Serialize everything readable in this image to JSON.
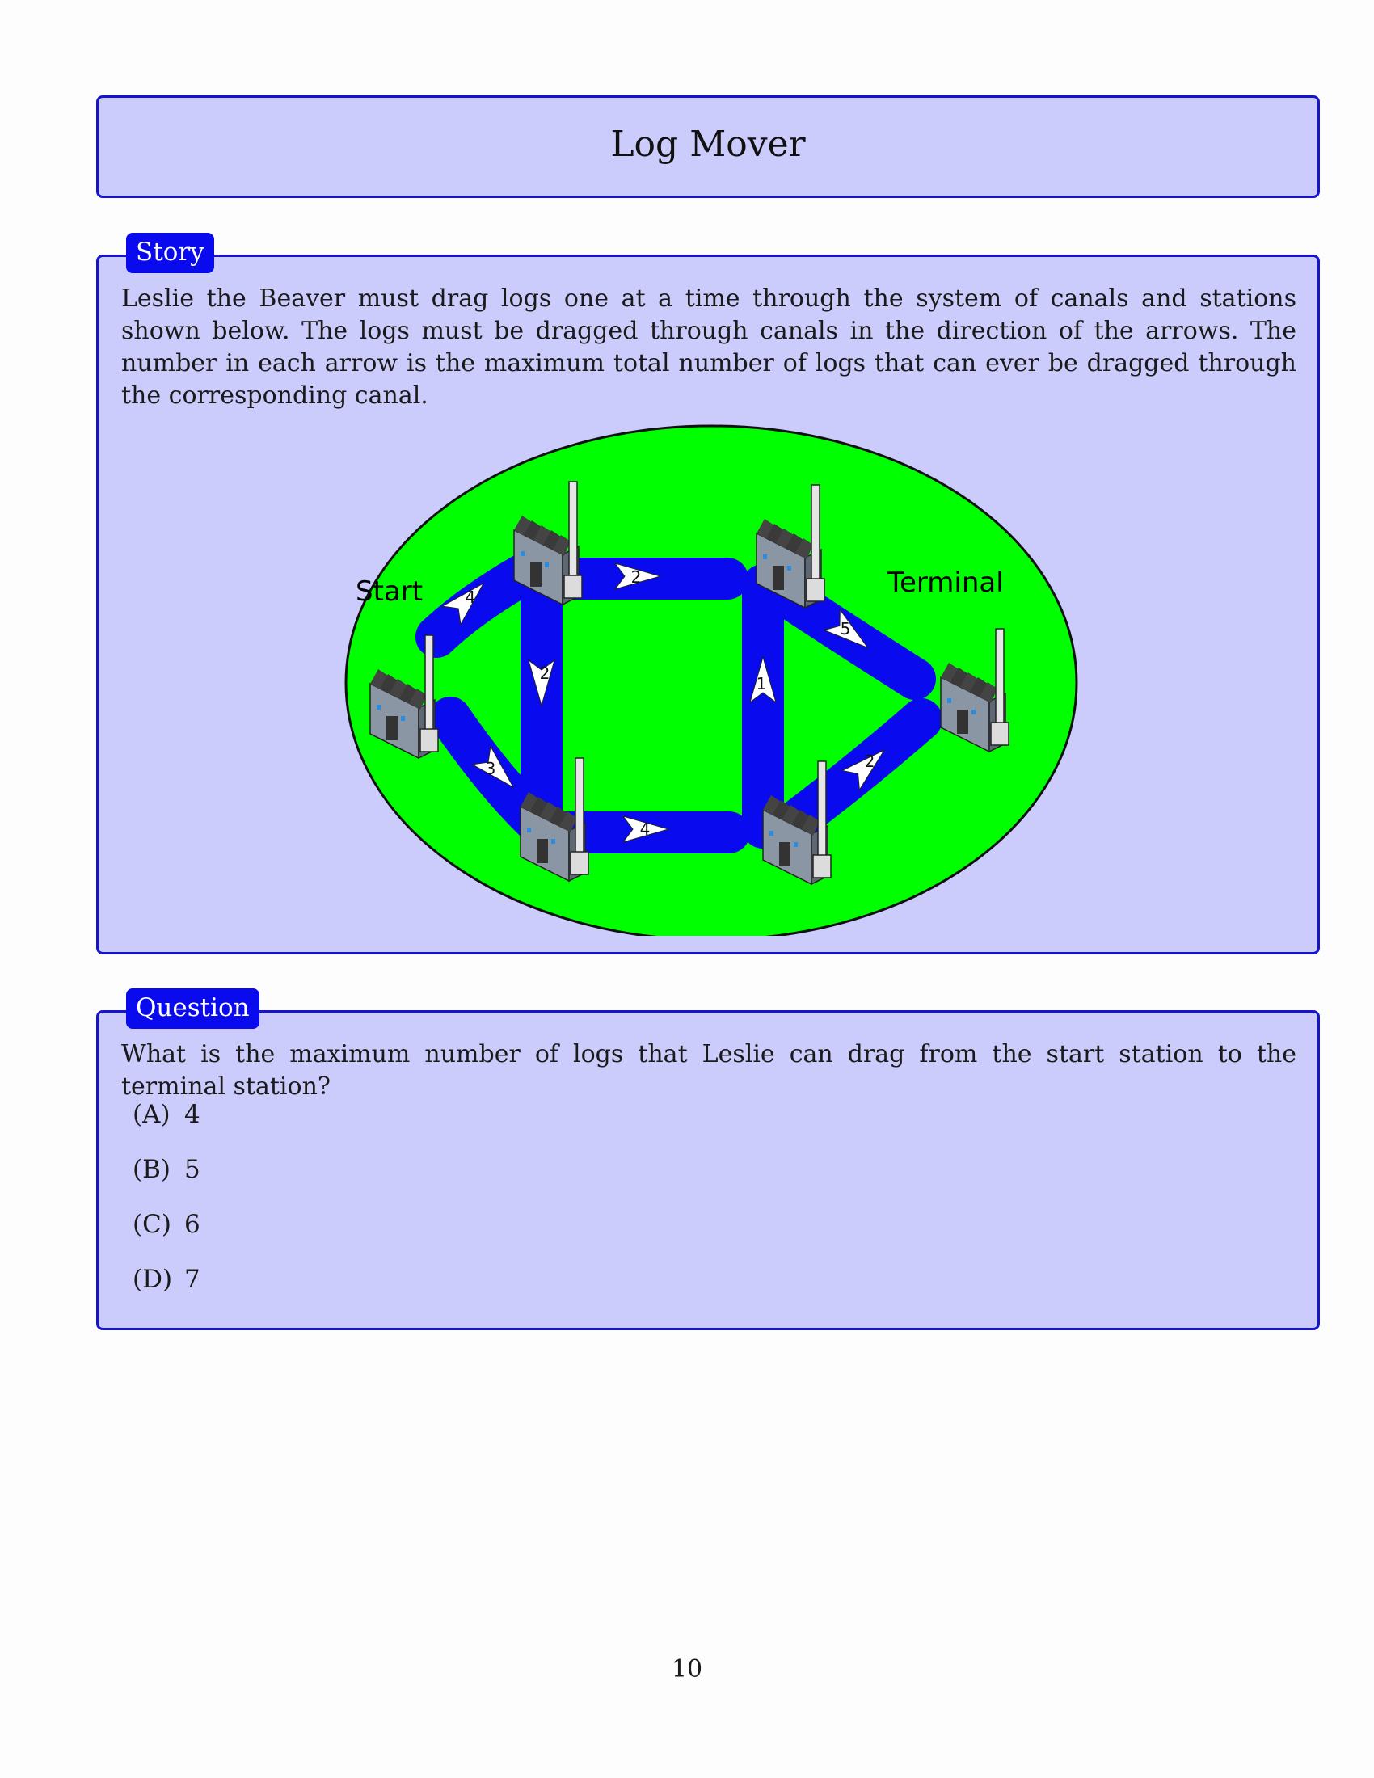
{
  "title": "Log Mover",
  "story": {
    "tab_label": "Story",
    "text": "Leslie the Beaver must drag logs one at a time through the system of canals and stations shown below. The logs must be dragged through canals in the direction of the arrows. The number in each arrow is the maximum total number of logs that can ever be dragged through the corresponding canal."
  },
  "diagram": {
    "start_label": "Start",
    "terminal_label": "Terminal",
    "stations": [
      "Start",
      "Top-left",
      "Top-right",
      "Terminal",
      "Bottom-left",
      "Bottom-right"
    ],
    "canals": [
      {
        "from": "Start",
        "to": "Top-left",
        "capacity": "4"
      },
      {
        "from": "Start",
        "to": "Bottom-left",
        "capacity": "3"
      },
      {
        "from": "Top-left",
        "to": "Top-right",
        "capacity": "2"
      },
      {
        "from": "Top-left",
        "to": "Bottom-left",
        "capacity": "2"
      },
      {
        "from": "Bottom-left",
        "to": "Bottom-right",
        "capacity": "4"
      },
      {
        "from": "Bottom-right",
        "to": "Top-right",
        "capacity": "1"
      },
      {
        "from": "Top-right",
        "to": "Terminal",
        "capacity": "5"
      },
      {
        "from": "Bottom-right",
        "to": "Terminal",
        "capacity": "2"
      }
    ],
    "colors": {
      "field": "#00ff00",
      "canal": "#0a0aee",
      "arrow": "#ffffff"
    }
  },
  "question": {
    "tab_label": "Question",
    "text": "What is the maximum number of logs that Leslie can drag from the start station to the terminal station?",
    "choices": [
      {
        "label": "(A)",
        "value": "4"
      },
      {
        "label": "(B)",
        "value": "5"
      },
      {
        "label": "(C)",
        "value": "6"
      },
      {
        "label": "(D)",
        "value": "7"
      }
    ]
  },
  "page_number": "10"
}
